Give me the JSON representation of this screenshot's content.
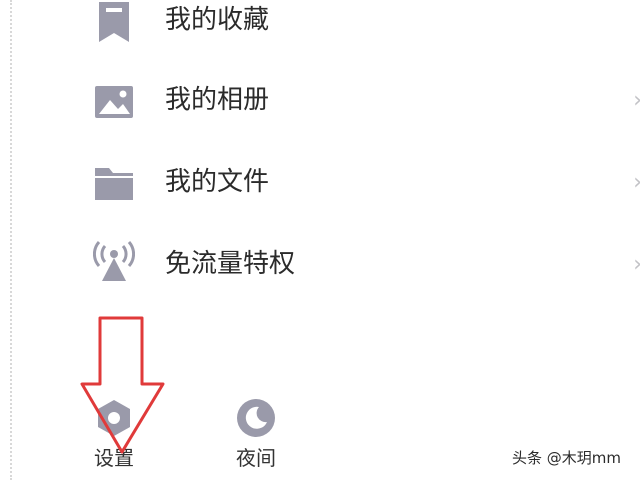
{
  "menu": {
    "items": [
      {
        "label": "我的收藏",
        "icon": "bookmark-icon"
      },
      {
        "label": "我的相册",
        "icon": "image-icon"
      },
      {
        "label": "我的文件",
        "icon": "folder-icon"
      },
      {
        "label": "免流量特权",
        "icon": "signal-tower-icon"
      }
    ],
    "chevron": "›"
  },
  "bottom": {
    "settings_label": "设置",
    "night_label": "夜间"
  },
  "watermark": "头条 @木玥mm",
  "colors": {
    "icon_gray": "#9a9aaa",
    "arrow_red": "#e03a3a"
  }
}
